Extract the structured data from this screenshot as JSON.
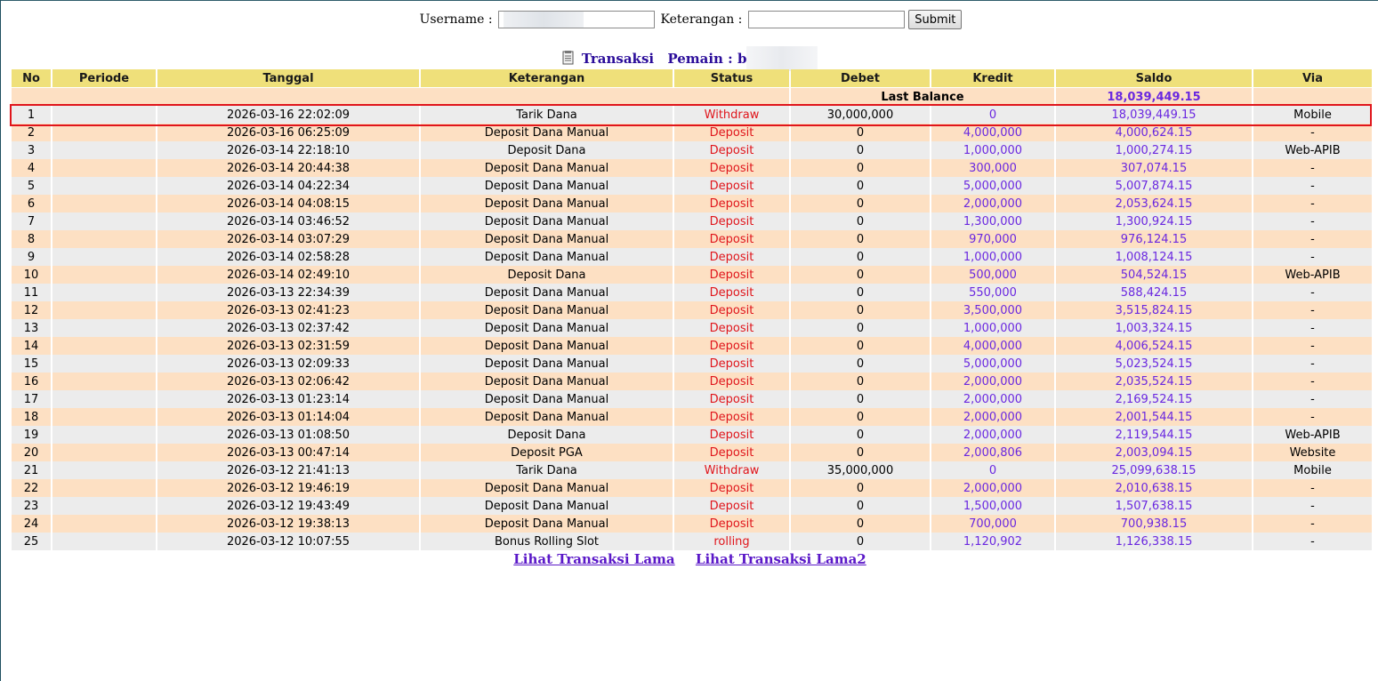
{
  "form": {
    "username_label": "Username :",
    "username_value": "",
    "keterangan_label": "Keterangan :",
    "keterangan_value": "",
    "submit_label": "Submit"
  },
  "title": {
    "transaksi": "Transaksi",
    "pemain_label": "Pemain : b"
  },
  "table": {
    "headers": [
      "No",
      "Periode",
      "Tanggal",
      "Keterangan",
      "Status",
      "Debet",
      "Kredit",
      "Saldo",
      "Via"
    ],
    "last_balance_label": "Last Balance",
    "last_balance_value": "18,039,449.15",
    "rows": [
      {
        "no": "1",
        "periode": "",
        "tanggal": "2026-03-16 22:02:09",
        "keterangan": "Tarik Dana",
        "status": "Withdraw",
        "debet": "30,000,000",
        "kredit": "0",
        "saldo": "18,039,449.15",
        "via": "Mobile"
      },
      {
        "no": "2",
        "periode": "",
        "tanggal": "2026-03-16 06:25:09",
        "keterangan": "Deposit Dana Manual",
        "status": "Deposit",
        "debet": "0",
        "kredit": "4,000,000",
        "saldo": "4,000,624.15",
        "via": "-"
      },
      {
        "no": "3",
        "periode": "",
        "tanggal": "2026-03-14 22:18:10",
        "keterangan": "Deposit Dana",
        "status": "Deposit",
        "debet": "0",
        "kredit": "1,000,000",
        "saldo": "1,000,274.15",
        "via": "Web-APIB"
      },
      {
        "no": "4",
        "periode": "",
        "tanggal": "2026-03-14 20:44:38",
        "keterangan": "Deposit Dana Manual",
        "status": "Deposit",
        "debet": "0",
        "kredit": "300,000",
        "saldo": "307,074.15",
        "via": "-"
      },
      {
        "no": "5",
        "periode": "",
        "tanggal": "2026-03-14 04:22:34",
        "keterangan": "Deposit Dana Manual",
        "status": "Deposit",
        "debet": "0",
        "kredit": "5,000,000",
        "saldo": "5,007,874.15",
        "via": "-"
      },
      {
        "no": "6",
        "periode": "",
        "tanggal": "2026-03-14 04:08:15",
        "keterangan": "Deposit Dana Manual",
        "status": "Deposit",
        "debet": "0",
        "kredit": "2,000,000",
        "saldo": "2,053,624.15",
        "via": "-"
      },
      {
        "no": "7",
        "periode": "",
        "tanggal": "2026-03-14 03:46:52",
        "keterangan": "Deposit Dana Manual",
        "status": "Deposit",
        "debet": "0",
        "kredit": "1,300,000",
        "saldo": "1,300,924.15",
        "via": "-"
      },
      {
        "no": "8",
        "periode": "",
        "tanggal": "2026-03-14 03:07:29",
        "keterangan": "Deposit Dana Manual",
        "status": "Deposit",
        "debet": "0",
        "kredit": "970,000",
        "saldo": "976,124.15",
        "via": "-"
      },
      {
        "no": "9",
        "periode": "",
        "tanggal": "2026-03-14 02:58:28",
        "keterangan": "Deposit Dana Manual",
        "status": "Deposit",
        "debet": "0",
        "kredit": "1,000,000",
        "saldo": "1,008,124.15",
        "via": "-"
      },
      {
        "no": "10",
        "periode": "",
        "tanggal": "2026-03-14 02:49:10",
        "keterangan": "Deposit Dana",
        "status": "Deposit",
        "debet": "0",
        "kredit": "500,000",
        "saldo": "504,524.15",
        "via": "Web-APIB"
      },
      {
        "no": "11",
        "periode": "",
        "tanggal": "2026-03-13 22:34:39",
        "keterangan": "Deposit Dana Manual",
        "status": "Deposit",
        "debet": "0",
        "kredit": "550,000",
        "saldo": "588,424.15",
        "via": "-"
      },
      {
        "no": "12",
        "periode": "",
        "tanggal": "2026-03-13 02:41:23",
        "keterangan": "Deposit Dana Manual",
        "status": "Deposit",
        "debet": "0",
        "kredit": "3,500,000",
        "saldo": "3,515,824.15",
        "via": "-"
      },
      {
        "no": "13",
        "periode": "",
        "tanggal": "2026-03-13 02:37:42",
        "keterangan": "Deposit Dana Manual",
        "status": "Deposit",
        "debet": "0",
        "kredit": "1,000,000",
        "saldo": "1,003,324.15",
        "via": "-"
      },
      {
        "no": "14",
        "periode": "",
        "tanggal": "2026-03-13 02:31:59",
        "keterangan": "Deposit Dana Manual",
        "status": "Deposit",
        "debet": "0",
        "kredit": "4,000,000",
        "saldo": "4,006,524.15",
        "via": "-"
      },
      {
        "no": "15",
        "periode": "",
        "tanggal": "2026-03-13 02:09:33",
        "keterangan": "Deposit Dana Manual",
        "status": "Deposit",
        "debet": "0",
        "kredit": "5,000,000",
        "saldo": "5,023,524.15",
        "via": "-"
      },
      {
        "no": "16",
        "periode": "",
        "tanggal": "2026-03-13 02:06:42",
        "keterangan": "Deposit Dana Manual",
        "status": "Deposit",
        "debet": "0",
        "kredit": "2,000,000",
        "saldo": "2,035,524.15",
        "via": "-"
      },
      {
        "no": "17",
        "periode": "",
        "tanggal": "2026-03-13 01:23:14",
        "keterangan": "Deposit Dana Manual",
        "status": "Deposit",
        "debet": "0",
        "kredit": "2,000,000",
        "saldo": "2,169,524.15",
        "via": "-"
      },
      {
        "no": "18",
        "periode": "",
        "tanggal": "2026-03-13 01:14:04",
        "keterangan": "Deposit Dana Manual",
        "status": "Deposit",
        "debet": "0",
        "kredit": "2,000,000",
        "saldo": "2,001,544.15",
        "via": "-"
      },
      {
        "no": "19",
        "periode": "",
        "tanggal": "2026-03-13 01:08:50",
        "keterangan": "Deposit Dana",
        "status": "Deposit",
        "debet": "0",
        "kredit": "2,000,000",
        "saldo": "2,119,544.15",
        "via": "Web-APIB"
      },
      {
        "no": "20",
        "periode": "",
        "tanggal": "2026-03-13 00:47:14",
        "keterangan": "Deposit PGA",
        "status": "Deposit",
        "debet": "0",
        "kredit": "2,000,806",
        "saldo": "2,003,094.15",
        "via": "Website"
      },
      {
        "no": "21",
        "periode": "",
        "tanggal": "2026-03-12 21:41:13",
        "keterangan": "Tarik Dana",
        "status": "Withdraw",
        "debet": "35,000,000",
        "kredit": "0",
        "saldo": "25,099,638.15",
        "via": "Mobile"
      },
      {
        "no": "22",
        "periode": "",
        "tanggal": "2026-03-12 19:46:19",
        "keterangan": "Deposit Dana Manual",
        "status": "Deposit",
        "debet": "0",
        "kredit": "2,000,000",
        "saldo": "2,010,638.15",
        "via": "-"
      },
      {
        "no": "23",
        "periode": "",
        "tanggal": "2026-03-12 19:43:49",
        "keterangan": "Deposit Dana Manual",
        "status": "Deposit",
        "debet": "0",
        "kredit": "1,500,000",
        "saldo": "1,507,638.15",
        "via": "-"
      },
      {
        "no": "24",
        "periode": "",
        "tanggal": "2026-03-12 19:38:13",
        "keterangan": "Deposit Dana Manual",
        "status": "Deposit",
        "debet": "0",
        "kredit": "700,000",
        "saldo": "700,938.15",
        "via": "-"
      },
      {
        "no": "25",
        "periode": "",
        "tanggal": "2026-03-12 10:07:55",
        "keterangan": "Bonus Rolling Slot",
        "status": "rolling",
        "debet": "0",
        "kredit": "1,120,902",
        "saldo": "1,126,338.15",
        "via": "-"
      }
    ]
  },
  "links": {
    "old1": "Lihat Transaksi Lama",
    "old2": "Lihat Transaksi Lama2"
  },
  "colors": {
    "header_bg": "#efe07a",
    "row_even": "#ececec",
    "row_odd": "#fde0c3",
    "status_red": "#e0151b",
    "value_purple": "#6a28e0",
    "title_purple": "#2b0d9a"
  },
  "icons": {
    "title_icon": "document-icon"
  }
}
